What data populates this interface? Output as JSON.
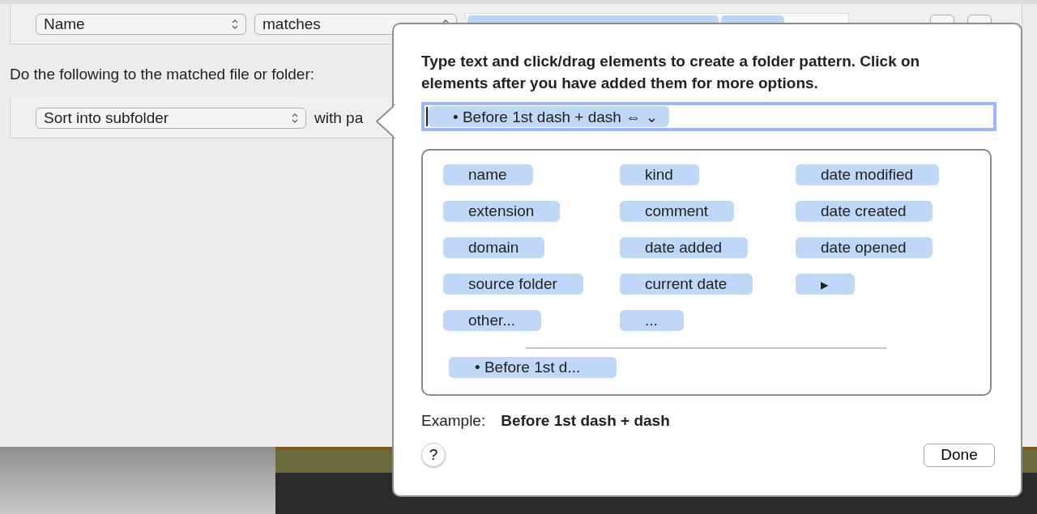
{
  "condition_row": {
    "attribute": "Name",
    "operator": "matches"
  },
  "action_label": "Do the following to the matched file or folder:",
  "action_row": {
    "action": "Sort into subfolder",
    "with_label": "with pa"
  },
  "popover": {
    "instructions": "Type text and click/drag elements to create a folder pattern. Click on elements after you have added them for more options.",
    "pattern_tokens": [
      {
        "label": "• Before 1st dash + dash ⇔ ⌄"
      }
    ],
    "elements": [
      {
        "label": "name"
      },
      {
        "label": "kind"
      },
      {
        "label": "date modified"
      },
      {
        "label": "extension"
      },
      {
        "label": "comment"
      },
      {
        "label": "date created"
      },
      {
        "label": "domain"
      },
      {
        "label": "date added"
      },
      {
        "label": "date opened"
      },
      {
        "label": "source folder"
      },
      {
        "label": "current date"
      },
      {
        "label": "▸"
      },
      {
        "label": "other..."
      },
      {
        "label": "..."
      }
    ],
    "custom_elements": [
      {
        "label": "• Before 1st d..."
      }
    ],
    "example_label": "Example:",
    "example_value": "Before 1st dash + dash",
    "help": "?",
    "done": "Done"
  }
}
